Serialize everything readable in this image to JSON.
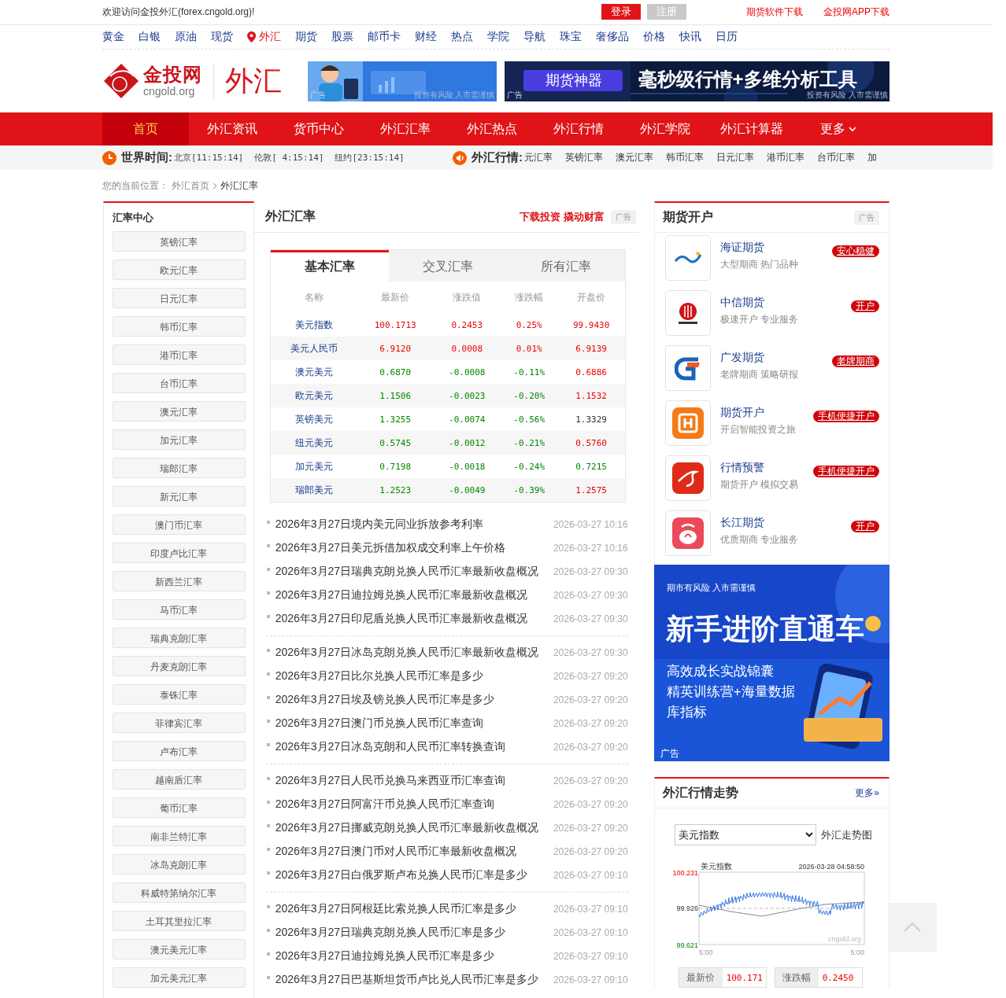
{
  "top_bar": {
    "welcome": "欢迎访问金投外汇(forex.cngold.org)!",
    "login": "登录",
    "register": "注册",
    "links": [
      "期货软件下载",
      "金投网APP下载"
    ]
  },
  "channels": [
    {
      "label": "黄金",
      "selected": false
    },
    {
      "label": "白银",
      "selected": false
    },
    {
      "label": "原油",
      "selected": false
    },
    {
      "label": "现货",
      "selected": false
    },
    {
      "label": "外汇",
      "selected": true
    },
    {
      "label": "期货",
      "selected": false
    },
    {
      "label": "股票",
      "selected": false
    },
    {
      "label": "邮币卡",
      "selected": false
    },
    {
      "label": "财经",
      "selected": false
    },
    {
      "label": "热点",
      "selected": false
    },
    {
      "label": "学院",
      "selected": false
    },
    {
      "label": "导航",
      "selected": false
    },
    {
      "label": "珠宝",
      "selected": false
    },
    {
      "label": "奢侈品",
      "selected": false
    },
    {
      "label": "价格",
      "selected": false
    },
    {
      "label": "快讯",
      "selected": false
    },
    {
      "label": "日历",
      "selected": false
    }
  ],
  "logo": {
    "brand": "金投网",
    "domain": "cngold.org",
    "section": "外汇"
  },
  "ads": [
    {
      "ad_label": "广告",
      "notice": "投资有风险 入市需谨慎"
    },
    {
      "tag": "期货神器",
      "headline": "毫秒级行情+多维分析工具",
      "ad_label": "广告",
      "notice": "投资有风险 入市需谨慎"
    }
  ],
  "nav": [
    {
      "label": "首页",
      "selected": true
    },
    {
      "label": "外汇资讯",
      "selected": false
    },
    {
      "label": "货币中心",
      "selected": false
    },
    {
      "label": "外汇汇率",
      "selected": false
    },
    {
      "label": "外汇热点",
      "selected": false
    },
    {
      "label": "外汇行情",
      "selected": false
    },
    {
      "label": "外汇学院",
      "selected": false
    },
    {
      "label": "外汇计算器",
      "selected": false
    },
    {
      "label": "更多",
      "selected": false
    }
  ],
  "clock": {
    "title": "世界时间:",
    "cities": [
      "北京[11:15:14]",
      "伦敦[ 4:15:14]",
      "纽约[23:15:14]"
    ]
  },
  "ticker": {
    "title": "外汇行情:",
    "items": [
      "元汇率",
      "英镑汇率",
      "澳元汇率",
      "韩币汇率",
      "日元汇率",
      "港币汇率",
      "台币汇率",
      "加"
    ]
  },
  "breadcrumb": {
    "prefix": "您的当前位置：",
    "links": [
      "外汇首页"
    ],
    "current": "外汇汇率"
  },
  "sidebar": {
    "title": "汇率中心",
    "items": [
      "英镑汇率",
      "欧元汇率",
      "日元汇率",
      "韩币汇率",
      "港币汇率",
      "台币汇率",
      "澳元汇率",
      "加元汇率",
      "瑞郎汇率",
      "新元汇率",
      "澳门币汇率",
      "印度卢比汇率",
      "新西兰汇率",
      "马币汇率",
      "瑞典克朗汇率",
      "丹麦克朗汇率",
      "泰铢汇率",
      "菲律宾汇率",
      "卢布汇率",
      "越南盾汇率",
      "葡币汇率",
      "南非兰特汇率",
      "冰岛克朗汇率",
      "科威特第纳尔汇率",
      "土耳其里拉汇率",
      "澳元美元汇率",
      "加元美元汇率"
    ]
  },
  "center": {
    "title": "外汇汇率",
    "promo": "下载投资 撬动财富",
    "ad_label": "广告",
    "tabs": [
      {
        "label": "基本汇率",
        "selected": true
      },
      {
        "label": "交叉汇率",
        "selected": false
      },
      {
        "label": "所有汇率",
        "selected": false
      }
    ],
    "columns": [
      "名称",
      "最新价",
      "涨跌值",
      "涨跌幅",
      "开盘价"
    ],
    "rows": [
      {
        "name": "美元指数",
        "values": [
          {
            "text": "100.1713",
            "color": "#ee0000"
          },
          {
            "text": "0.2453",
            "color": "#ee0000"
          },
          {
            "text": "0.25%",
            "color": "#ee0000"
          },
          {
            "text": "99.9430",
            "color": "#ee0000"
          }
        ]
      },
      {
        "name": "美元人民币",
        "values": [
          {
            "text": "6.9120",
            "color": "#ee0000"
          },
          {
            "text": "0.0008",
            "color": "#ee0000"
          },
          {
            "text": "0.01%",
            "color": "#ee0000"
          },
          {
            "text": "6.9139",
            "color": "#ee0000"
          }
        ]
      },
      {
        "name": "澳元美元",
        "values": [
          {
            "text": "0.6870",
            "color": "#008800"
          },
          {
            "text": "-0.0008",
            "color": "#008800"
          },
          {
            "text": "-0.11%",
            "color": "#008800"
          },
          {
            "text": "0.6886",
            "color": "#ee0000"
          }
        ]
      },
      {
        "name": "欧元美元",
        "values": [
          {
            "text": "1.1506",
            "color": "#008800"
          },
          {
            "text": "-0.0023",
            "color": "#008800"
          },
          {
            "text": "-0.20%",
            "color": "#008800"
          },
          {
            "text": "1.1532",
            "color": "#ee0000"
          }
        ]
      },
      {
        "name": "英镑美元",
        "values": [
          {
            "text": "1.3255",
            "color": "#008800"
          },
          {
            "text": "-0.0074",
            "color": "#008800"
          },
          {
            "text": "-0.56%",
            "color": "#008800"
          },
          {
            "text": "1.3329",
            "color": "#333333"
          }
        ]
      },
      {
        "name": "纽元美元",
        "values": [
          {
            "text": "0.5745",
            "color": "#008800"
          },
          {
            "text": "-0.0012",
            "color": "#008800"
          },
          {
            "text": "-0.21%",
            "color": "#008800"
          },
          {
            "text": "0.5760",
            "color": "#ee0000"
          }
        ]
      },
      {
        "name": "加元美元",
        "values": [
          {
            "text": "0.7198",
            "color": "#008800"
          },
          {
            "text": "-0.0018",
            "color": "#008800"
          },
          {
            "text": "-0.24%",
            "color": "#008800"
          },
          {
            "text": "0.7215",
            "color": "#008800"
          }
        ]
      },
      {
        "name": "瑞郎美元",
        "values": [
          {
            "text": "1.2523",
            "color": "#008800"
          },
          {
            "text": "-0.0049",
            "color": "#008800"
          },
          {
            "text": "-0.39%",
            "color": "#008800"
          },
          {
            "text": "1.2575",
            "color": "#ee0000"
          }
        ]
      }
    ],
    "news_groups": [
      [
        {
          "title": "2026年3月27日境内美元同业拆放参考利率",
          "time": "2026-03-27 10:16"
        },
        {
          "title": "2026年3月27日美元拆借加权成交利率上午价格",
          "time": "2026-03-27 10:16"
        },
        {
          "title": "2026年3月27日瑞典克朗兑换人民币汇率最新收盘概况",
          "time": "2026-03-27 09:30"
        },
        {
          "title": "2026年3月27日迪拉姆兑换人民币汇率最新收盘概况",
          "time": "2026-03-27 09:30"
        },
        {
          "title": "2026年3月27日印尼盾兑换人民币汇率最新收盘概况",
          "time": "2026-03-27 09:30"
        }
      ],
      [
        {
          "title": "2026年3月27日冰岛克朗兑换人民币汇率最新收盘概况",
          "time": "2026-03-27 09:30"
        },
        {
          "title": "2026年3月27日比尔兑换人民币汇率是多少",
          "time": "2026-03-27 09:20"
        },
        {
          "title": "2026年3月27日埃及镑兑换人民币汇率是多少",
          "time": "2026-03-27 09:20"
        },
        {
          "title": "2026年3月27日澳门币兑换人民币汇率查询",
          "time": "2026-03-27 09:20"
        },
        {
          "title": "2026年3月27日冰岛克朗和人民币汇率转换查询",
          "time": "2026-03-27 09:20"
        }
      ],
      [
        {
          "title": "2026年3月27日人民币兑换马来西亚币汇率查询",
          "time": "2026-03-27 09:20"
        },
        {
          "title": "2026年3月27日阿富汗币兑换人民币汇率查询",
          "time": "2026-03-27 09:20"
        },
        {
          "title": "2026年3月27日挪威克朗兑换人民币汇率最新收盘概况",
          "time": "2026-03-27 09:20"
        },
        {
          "title": "2026年3月27日澳门币对人民币汇率最新收盘概况",
          "time": "2026-03-27 09:20"
        },
        {
          "title": "2026年3月27日白俄罗斯卢布兑换人民币汇率是多少",
          "time": "2026-03-27 09:10"
        }
      ],
      [
        {
          "title": "2026年3月27日阿根廷比索兑换人民币汇率是多少",
          "time": "2026-03-27 09:10"
        },
        {
          "title": "2026年3月27日瑞典克朗兑换人民币汇率是多少",
          "time": "2026-03-27 09:10"
        },
        {
          "title": "2026年3月27日迪拉姆兑换人民币汇率是多少",
          "time": "2026-03-27 09:10"
        },
        {
          "title": "2026年3月27日巴基斯坦货币卢比兑人民币汇率是多少",
          "time": "2026-03-27 09:10"
        }
      ]
    ]
  },
  "accounts": {
    "title": "期货开户",
    "ad_label": "广告",
    "items": [
      {
        "name": "海证期货",
        "desc": "大型期商 热门品种",
        "badge": "安心稳健"
      },
      {
        "name": "中信期货",
        "desc": "极速开户 专业服务",
        "badge": "开户"
      },
      {
        "name": "广发期货",
        "desc": "老牌期商 策略研报",
        "badge": "老牌期商"
      },
      {
        "name": "期货开户",
        "desc": "开启智能投资之旅",
        "badge": "手机便捷开户"
      },
      {
        "name": "行情预警",
        "desc": "期货开户 模拟交易",
        "badge": "手机便捷开户"
      },
      {
        "name": "长江期货",
        "desc": "优质期商 专业服务",
        "badge": "开户"
      }
    ]
  },
  "banner": {
    "notice": "期市有风险 入市需谨慎",
    "headline": "新手进阶直通车",
    "lines": [
      "高效成长实战锦囊",
      "精英训练营+海量数据",
      "库指标"
    ],
    "ad_label": "广告"
  },
  "trend": {
    "title": "外汇行情走势",
    "more": "更多»",
    "select": "美元指数",
    "select_label": "外汇走势图",
    "chart_title": "美元指数",
    "chart_time": "2026-03-28 04:58:50",
    "y_labels": [
      "100.231",
      "99.926",
      "99.621"
    ],
    "x_labels": [
      "5:00",
      "5:00"
    ],
    "watermark": "cngold.org",
    "stats": [
      {
        "label": "最新价",
        "value": "100.171",
        "color": "#ee0000"
      },
      {
        "label": "涨跌幅",
        "value": "0.2450",
        "color": "#ee0000"
      }
    ]
  }
}
